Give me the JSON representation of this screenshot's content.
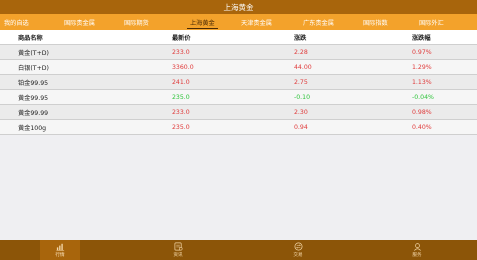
{
  "title": "上海黄金",
  "tabs": [
    {
      "label": "我的自选",
      "active": false
    },
    {
      "label": "国际贵金属",
      "active": false
    },
    {
      "label": "国际期货",
      "active": false
    },
    {
      "label": "上海黄金",
      "active": true
    },
    {
      "label": "天津贵金属",
      "active": false
    },
    {
      "label": "广东贵金属",
      "active": false
    },
    {
      "label": "国际指数",
      "active": false
    },
    {
      "label": "国际外汇",
      "active": false
    }
  ],
  "table": {
    "headers": {
      "name": "商品名称",
      "price": "最新价",
      "change": "涨跌",
      "pct": "涨跌幅"
    },
    "rows": [
      {
        "name": "黄金(T+D)",
        "price": "233.0",
        "change": "2.28",
        "pct": "0.97%",
        "direction": "up"
      },
      {
        "name": "白银(T+D)",
        "price": "3360.0",
        "change": "44.00",
        "pct": "1.29%",
        "direction": "up"
      },
      {
        "name": "铂金99.95",
        "price": "241.0",
        "change": "2.75",
        "pct": "1.13%",
        "direction": "up"
      },
      {
        "name": "黄金99.95",
        "price": "235.0",
        "change": "-0.10",
        "pct": "-0.04%",
        "direction": "down"
      },
      {
        "name": "黄金99.99",
        "price": "233.0",
        "change": "2.30",
        "pct": "0.98%",
        "direction": "up"
      },
      {
        "name": "黄金100g",
        "price": "235.0",
        "change": "0.94",
        "pct": "0.40%",
        "direction": "up"
      }
    ]
  },
  "bottom_nav": [
    {
      "label": "行情",
      "icon": "chart-bars-icon",
      "active": true
    },
    {
      "label": "资讯",
      "icon": "news-icon",
      "active": false
    },
    {
      "label": "交易",
      "icon": "trade-icon",
      "active": false
    },
    {
      "label": "服务",
      "icon": "service-icon",
      "active": false
    }
  ],
  "colors": {
    "up": "#e03a3a",
    "down": "#2ec43a",
    "accent": "#f3a22b",
    "title_bg": "#a8650c",
    "nav_bg": "#8c5508"
  }
}
